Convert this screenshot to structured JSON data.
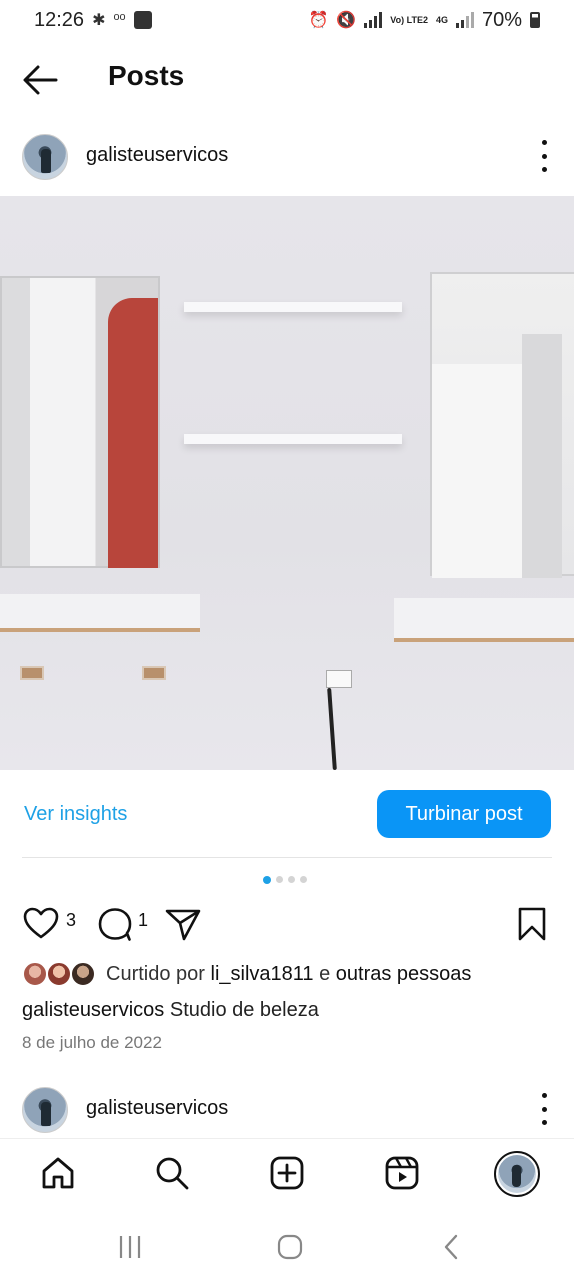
{
  "status_bar": {
    "time": "12:26",
    "network": "Vo) LTE2",
    "network_type": "4G",
    "battery": "70%"
  },
  "header": {
    "title": "Posts"
  },
  "post": {
    "username": "galisteuservicos",
    "insights_label": "Ver insights",
    "boost_label": "Turbinar post",
    "carousel": {
      "count": 4,
      "active_index": 0
    },
    "like_count": "3",
    "comment_count": "1",
    "likes_prefix": "Curtido por",
    "liked_by_user": "li_silva1811",
    "likes_connector": "e",
    "likes_suffix": "outras pessoas",
    "caption_user": "galisteuservicos",
    "caption_text": "Studio de beleza",
    "date": "8 de julho de 2022"
  },
  "next_post": {
    "username": "galisteuservicos"
  },
  "bottom_nav": {
    "items": [
      "home-icon",
      "search-icon",
      "create-icon",
      "reels-icon",
      "profile-avatar"
    ]
  },
  "colors": {
    "accent": "#0a95f6",
    "link": "#1ea1e6"
  }
}
